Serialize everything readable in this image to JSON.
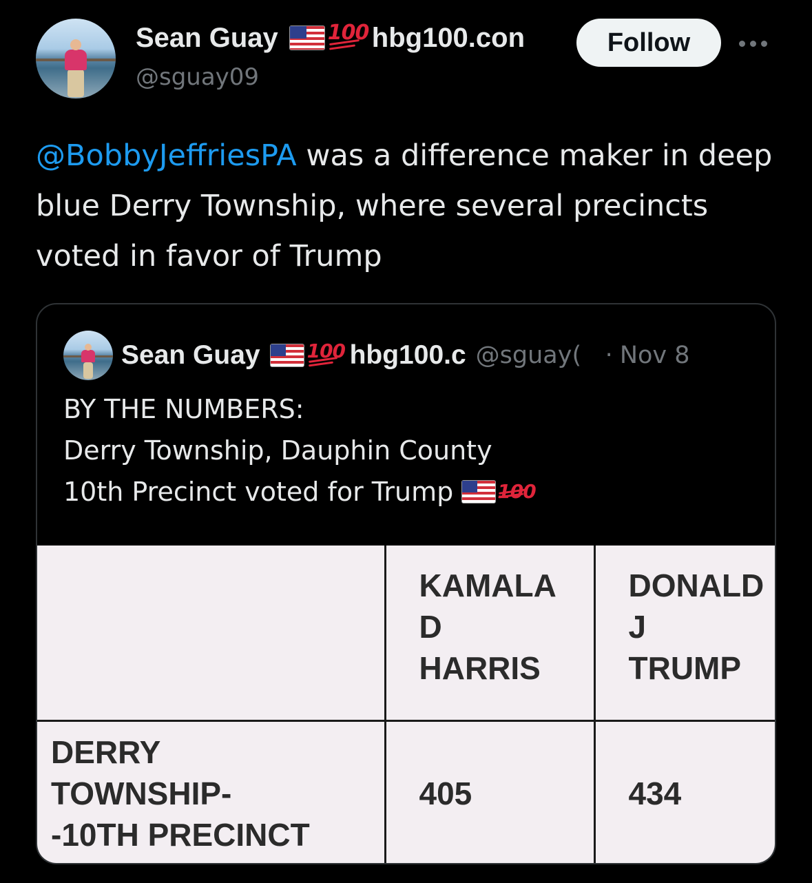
{
  "post": {
    "author": {
      "display_name": "Sean Guay",
      "emoji": [
        "us-flag",
        "hundred-points"
      ],
      "name_suffix": "hbg100.con",
      "handle": "@sguay09"
    },
    "follow_label": "Follow",
    "text_mention": "@BobbyJeffriesPA",
    "text_body": " was a difference maker in deep blue Derry Township, where several precincts voted in favor of Trump"
  },
  "quoted_post": {
    "author": {
      "display_name": "Sean Guay",
      "name_suffix": "hbg100.c",
      "handle": "@sguay(",
      "separator": "·",
      "date": "Nov 8"
    },
    "lines": [
      "BY THE NUMBERS:",
      "Derry Township, Dauphin County",
      "10th Precinct voted for Trump"
    ],
    "table": {
      "headers": [
        [],
        [
          "KAMALA",
          "D",
          "HARRIS"
        ],
        [
          "DONALD",
          "J",
          "TRUMP"
        ]
      ],
      "row": {
        "label": [
          "DERRY",
          "TOWNSHIP-",
          "-10TH PRECINCT"
        ],
        "harris": "405",
        "trump": "434"
      }
    }
  },
  "icons": {
    "more": "more-options-icon",
    "flag": "us-flag-emoji",
    "hundred": "hundred-points-emoji",
    "hundred_glyph": "100"
  },
  "colors": {
    "background": "#000000",
    "text": "#e7e9ea",
    "muted": "#71767b",
    "link": "#1d9bf0",
    "follow_bg": "#eff3f4"
  }
}
